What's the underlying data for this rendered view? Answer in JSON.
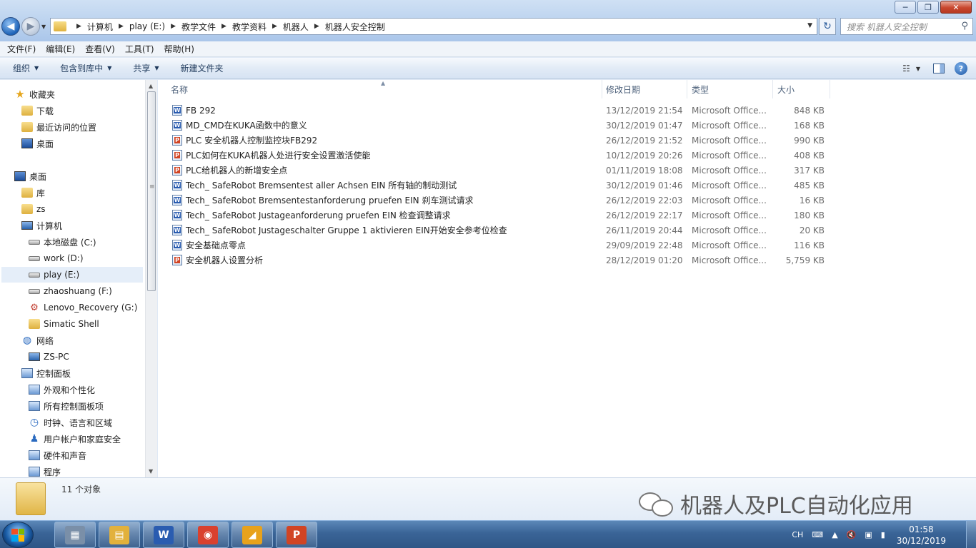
{
  "window": {
    "controls": [
      "─",
      "❐",
      "✕"
    ]
  },
  "address": {
    "breadcrumb": [
      "计算机",
      "play (E:)",
      "教学文件",
      "教学资料",
      "机器人",
      "机器人安全控制"
    ],
    "search_placeholder": "搜索 机器人安全控制"
  },
  "menu": [
    "文件(F)",
    "编辑(E)",
    "查看(V)",
    "工具(T)",
    "帮助(H)"
  ],
  "commands": [
    {
      "label": "组织",
      "dropdown": true
    },
    {
      "label": "包含到库中",
      "dropdown": true
    },
    {
      "label": "共享",
      "dropdown": true
    },
    {
      "label": "新建文件夹",
      "dropdown": false
    }
  ],
  "nav": [
    {
      "label": "收藏夹",
      "icon": "star-icon",
      "indent": 0
    },
    {
      "label": "下载",
      "icon": "download-folder-icon",
      "indent": 1
    },
    {
      "label": "最近访问的位置",
      "icon": "recent-places-icon",
      "indent": 1
    },
    {
      "label": "桌面",
      "icon": "desktop-icon",
      "indent": 1
    },
    {
      "label": "桌面",
      "icon": "desktop-icon",
      "indent": 0
    },
    {
      "label": "库",
      "icon": "library-icon",
      "indent": 1
    },
    {
      "label": "zs",
      "icon": "user-folder-icon",
      "indent": 1
    },
    {
      "label": "计算机",
      "icon": "computer-icon",
      "indent": 1
    },
    {
      "label": "本地磁盘 (C:)",
      "icon": "drive-icon",
      "indent": 2
    },
    {
      "label": "work (D:)",
      "icon": "drive-icon",
      "indent": 2
    },
    {
      "label": "play (E:)",
      "icon": "drive-icon",
      "indent": 2,
      "selected": true
    },
    {
      "label": "zhaoshuang (F:)",
      "icon": "drive-icon",
      "indent": 2
    },
    {
      "label": "Lenovo_Recovery (G:)",
      "icon": "recovery-drive-icon",
      "indent": 2
    },
    {
      "label": "Simatic Shell",
      "icon": "folder-icon",
      "indent": 2
    },
    {
      "label": "网络",
      "icon": "network-icon",
      "indent": 1
    },
    {
      "label": "ZS-PC",
      "icon": "computer-icon",
      "indent": 2
    },
    {
      "label": "控制面板",
      "icon": "control-panel-icon",
      "indent": 1
    },
    {
      "label": "外观和个性化",
      "icon": "appearance-icon",
      "indent": 2
    },
    {
      "label": "所有控制面板项",
      "icon": "control-panel-icon",
      "indent": 2
    },
    {
      "label": "时钟、语言和区域",
      "icon": "clock-region-icon",
      "indent": 2
    },
    {
      "label": "用户帐户和家庭安全",
      "icon": "user-accounts-icon",
      "indent": 2
    },
    {
      "label": "硬件和声音",
      "icon": "hardware-sound-icon",
      "indent": 2
    },
    {
      "label": "程序",
      "icon": "programs-icon",
      "indent": 2
    }
  ],
  "columns": {
    "name": "名称",
    "date": "修改日期",
    "type": "类型",
    "size": "大小"
  },
  "files": [
    {
      "name": "FB 292",
      "date": "13/12/2019 21:54",
      "type": "Microsoft Office...",
      "size": "848 KB",
      "kind": "doc"
    },
    {
      "name": "MD_CMD在KUKA函数中的意义",
      "date": "30/12/2019 01:47",
      "type": "Microsoft Office...",
      "size": "168 KB",
      "kind": "doc"
    },
    {
      "name": "PLC 安全机器人控制监控块FB292",
      "date": "26/12/2019 21:52",
      "type": "Microsoft Office...",
      "size": "990 KB",
      "kind": "ppt"
    },
    {
      "name": "PLC如何在KUKA机器人处进行安全设置激活使能",
      "date": "10/12/2019 20:26",
      "type": "Microsoft Office...",
      "size": "408 KB",
      "kind": "ppt"
    },
    {
      "name": "PLC给机器人的新增安全点",
      "date": "01/11/2019 18:08",
      "type": "Microsoft Office...",
      "size": "317 KB",
      "kind": "ppt"
    },
    {
      "name": "Tech_ SafeRobot Bremsentest aller Achsen EIN 所有轴的制动测试",
      "date": "30/12/2019 01:46",
      "type": "Microsoft Office...",
      "size": "485 KB",
      "kind": "doc"
    },
    {
      "name": "Tech_ SafeRobot Bremsentestanforderung pruefen EIN 刹车测试请求",
      "date": "26/12/2019 22:03",
      "type": "Microsoft Office...",
      "size": "16 KB",
      "kind": "doc"
    },
    {
      "name": "Tech_ SafeRobot Justageanforderung pruefen EIN 检查调整请求",
      "date": "26/12/2019 22:17",
      "type": "Microsoft Office...",
      "size": "180 KB",
      "kind": "doc"
    },
    {
      "name": "Tech_ SafeRobot Justageschalter Gruppe 1 aktivieren EIN开始安全参考位检查",
      "date": "26/11/2019 20:44",
      "type": "Microsoft Office...",
      "size": "20 KB",
      "kind": "doc"
    },
    {
      "name": "安全基础点零点",
      "date": "29/09/2019 22:48",
      "type": "Microsoft Office...",
      "size": "116 KB",
      "kind": "doc"
    },
    {
      "name": "安全机器人设置分析",
      "date": "28/12/2019 01:20",
      "type": "Microsoft Office...",
      "size": "5,759 KB",
      "kind": "ppt"
    }
  ],
  "details": {
    "count": "11 个对象"
  },
  "watermark": {
    "text": "机器人及PLC自动化应用"
  },
  "taskbar": {
    "apps": [
      {
        "name": "calculator",
        "glyph": "▦",
        "color": "#7a8fa8"
      },
      {
        "name": "explorer",
        "glyph": "▤",
        "color": "#e2b13c"
      },
      {
        "name": "word",
        "glyph": "W",
        "color": "#2a5cb0"
      },
      {
        "name": "chrome",
        "glyph": "◉",
        "color": "#d9412e"
      },
      {
        "name": "app",
        "glyph": "◢",
        "color": "#e8a21c"
      },
      {
        "name": "powerpoint",
        "glyph": "P",
        "color": "#d14424"
      }
    ],
    "lang": "CH",
    "time": "01:58",
    "date": "30/12/2019"
  }
}
